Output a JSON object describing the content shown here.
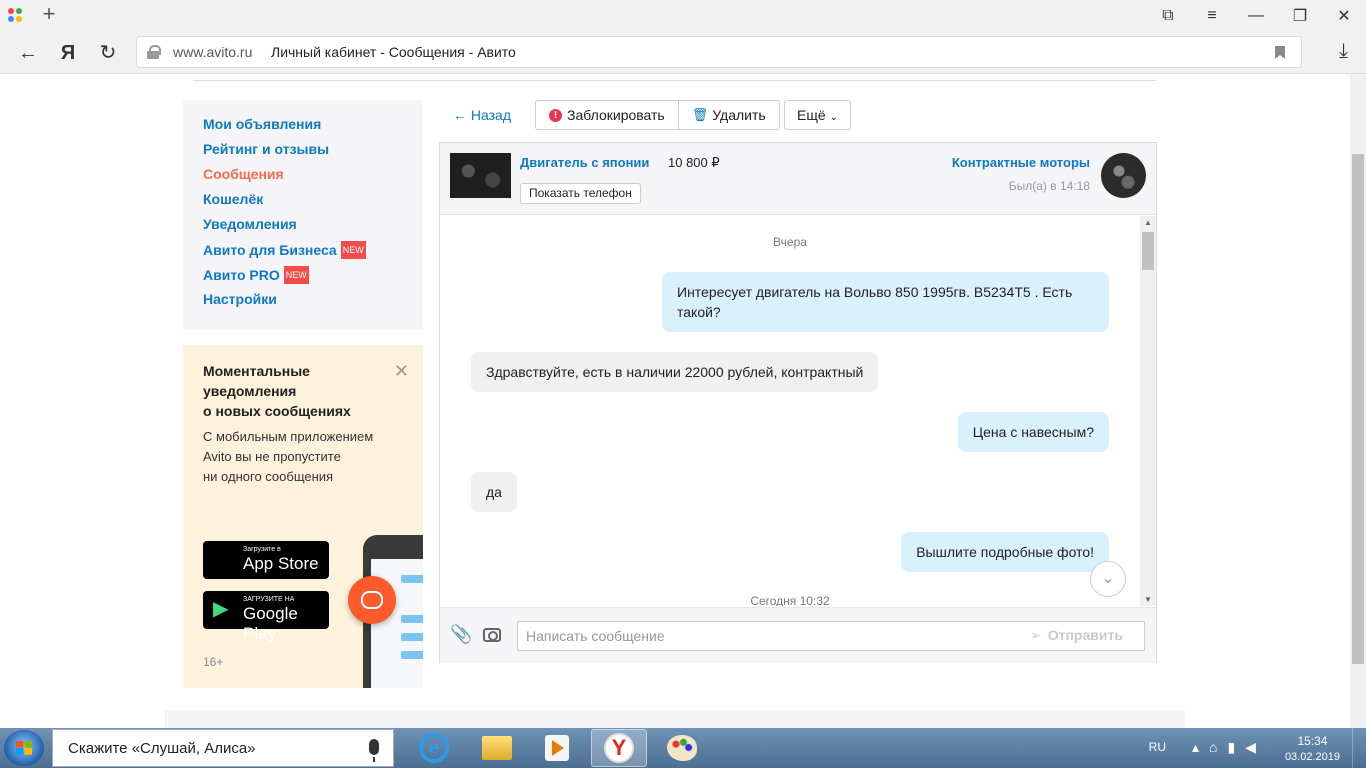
{
  "browser": {
    "url_domain": "www.avito.ru",
    "page_title": "Личный кабинет - Сообщения - Авито",
    "yandex_label": "Я"
  },
  "sidebar": {
    "items": [
      {
        "label": "Мои объявления",
        "active": false
      },
      {
        "label": "Рейтинг и отзывы",
        "active": false
      },
      {
        "label": "Сообщения",
        "active": true
      },
      {
        "label": "Кошелёк",
        "active": false
      },
      {
        "label": "Уведомления",
        "active": false
      },
      {
        "label": "Авито для Бизнеса",
        "active": false,
        "badge": "NEW"
      },
      {
        "label": "Авито PRO",
        "active": false,
        "badge": "NEW"
      },
      {
        "label": "Настройки",
        "active": false
      }
    ]
  },
  "promo": {
    "title_line1": "Моментальные",
    "title_line2": "уведомления",
    "title_line3": "о новых сообщениях",
    "text_line1": "С мобильным приложением",
    "text_line2": "Avito вы не пропустите",
    "text_line3": "ни одного сообщения",
    "appstore_small": "Загрузите в",
    "appstore_big": "App Store",
    "googleplay_small": "ЗАГРУЗИТЕ НА",
    "googleplay_big": "Google Play",
    "age": "16+"
  },
  "toolbar": {
    "back": "← Назад",
    "block": "Заблокировать",
    "delete": "Удалить",
    "more": "Ещё"
  },
  "chat": {
    "item_title": "Двигатель с японии",
    "item_price": "10 800 ₽",
    "show_phone": "Показать телефон",
    "seller_name": "Контрактные моторы",
    "seller_seen": "Был(а) в 14:18",
    "date_yesterday": "Вчера",
    "date_today": "Сегодня 10:32",
    "messages": [
      {
        "dir": "out",
        "text": "Интересует двигатель на Вольво 850 1995гв. B5234T5 . Есть такой?"
      },
      {
        "dir": "in",
        "text": "Здравствуйте, есть в наличии 22000 рублей, контрактный"
      },
      {
        "dir": "out",
        "text": "Цена с навесным?"
      },
      {
        "dir": "in",
        "text": "да"
      },
      {
        "dir": "out",
        "text": "Вышлите подробные фото!"
      }
    ],
    "input_placeholder": "Написать сообщение",
    "send_label": "Отправить"
  },
  "taskbar": {
    "alice_prompt": "Скажите «Слушай, Алиса»",
    "lang": "RU",
    "time": "15:34",
    "date": "03.02.2019"
  }
}
